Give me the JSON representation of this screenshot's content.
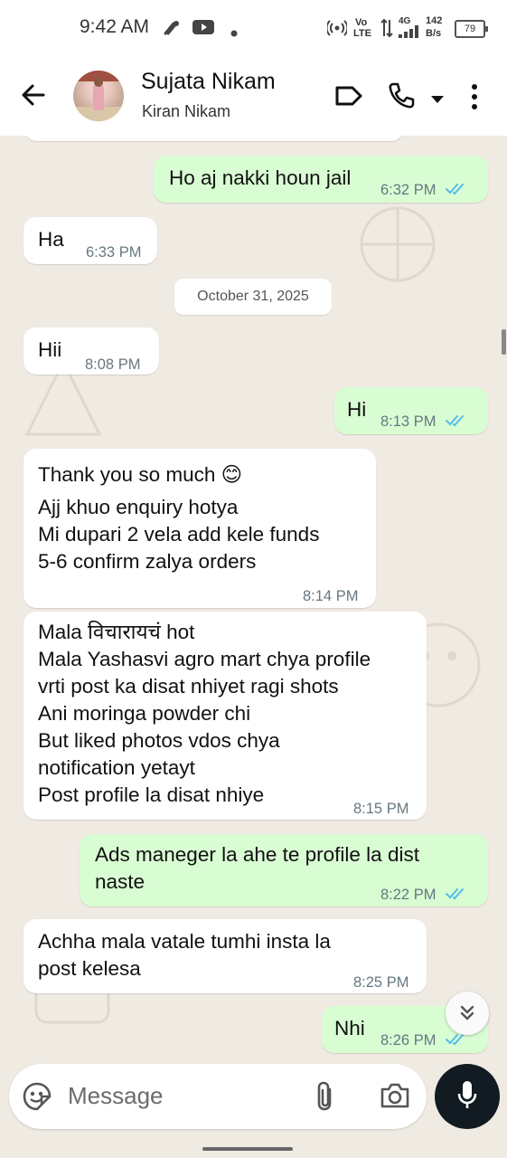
{
  "status_bar": {
    "time": "9:42 AM",
    "network_label_top": "Vo",
    "network_label_bottom": "LTE",
    "signal_gen": "4G",
    "speed_value": "142",
    "speed_unit": "B/s",
    "battery": "79",
    "icons": [
      "youtube-icon",
      "tools-icon",
      "hotspot-icon",
      "data-arrows-icon",
      "signal-icon",
      "battery-icon"
    ]
  },
  "header": {
    "contact_name": "Sujata Nikam",
    "contact_subtitle": "Kiran Nikam",
    "icons": [
      "back-arrow-icon",
      "label-icon",
      "phone-icon",
      "dropdown-icon",
      "more-vert-icon"
    ]
  },
  "messages": [
    {
      "id": "m1",
      "direction": "out",
      "text": "Ho aj nakki houn jail",
      "time": "6:32 PM",
      "read": true
    },
    {
      "id": "m2",
      "direction": "in",
      "text": "Ha",
      "time": "6:33 PM"
    },
    {
      "id": "m3",
      "direction": "in",
      "text": "Hii",
      "time": "8:08 PM"
    },
    {
      "id": "m4",
      "direction": "out",
      "text": "Hi",
      "time": "8:13 PM",
      "read": true
    },
    {
      "id": "m5",
      "direction": "in",
      "lines": [
        "Thank you so much 😊",
        "Ajj khuo enquiry hotya",
        "Mi dupari 2 vela add kele funds",
        "5-6 confirm zalya orders"
      ],
      "time": "8:14 PM"
    },
    {
      "id": "m6",
      "direction": "in",
      "lines": [
        "Mala विचारायचं hot",
        "Mala Yashasvi agro mart chya profile",
        "vrti post ka disat nhiyet ragi shots",
        "Ani moringa powder chi",
        "But liked photos vdos chya",
        "notification yetayt",
        "Post profile la disat nhiye"
      ],
      "time": "8:15 PM"
    },
    {
      "id": "m7",
      "direction": "out",
      "lines": [
        "Ads maneger la ahe te profile la dist",
        "naste"
      ],
      "time": "8:22 PM",
      "read": true
    },
    {
      "id": "m8",
      "direction": "in",
      "lines": [
        "Achha mala vatale tumhi insta la",
        "post kelesa"
      ],
      "time": "8:25 PM"
    },
    {
      "id": "m9",
      "direction": "out",
      "text": "Nhi",
      "time": "8:26 PM",
      "read": true
    }
  ],
  "date_separator": "October 31, 2025",
  "composer": {
    "placeholder": "Message",
    "icons": [
      "emoji-icon",
      "attach-icon",
      "camera-icon",
      "mic-icon"
    ]
  },
  "colors": {
    "chat_bg": "#efeae2",
    "bubble_in": "#ffffff",
    "bubble_out": "#d9fdd3",
    "read_ticks": "#53bdeb",
    "mic_bg": "#111b21"
  }
}
